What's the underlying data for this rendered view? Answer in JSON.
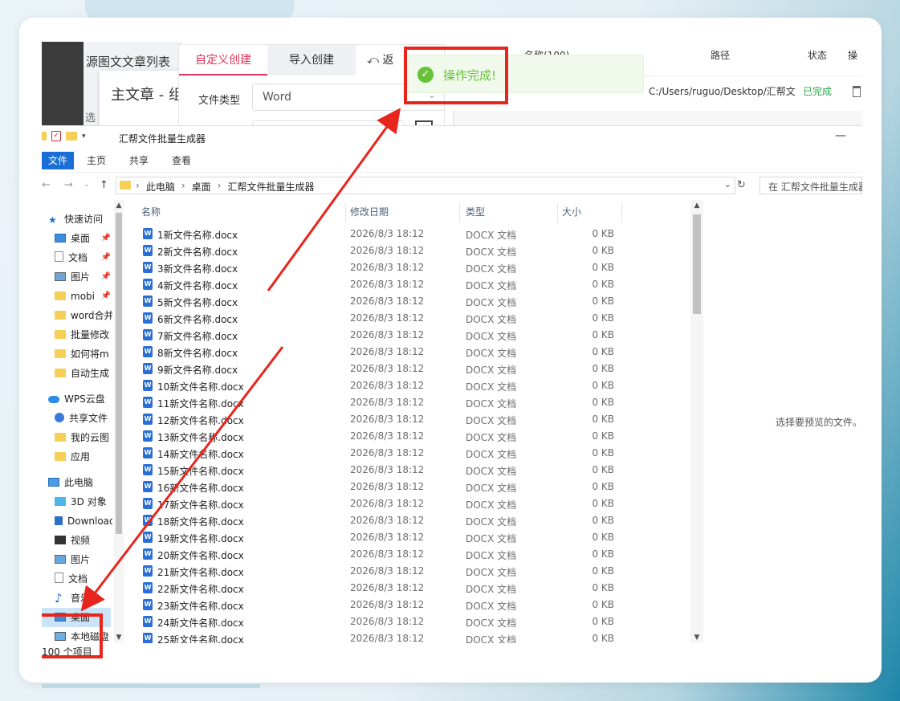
{
  "bg_app": {
    "title": "源图文文章列表",
    "dialog_title": "主文章 - 组",
    "select_label": "选",
    "tabs": [
      "自定义创建",
      "导入创建"
    ],
    "back_label": "返",
    "file_type_label": "文件类型",
    "file_type_value": "Word",
    "table": {
      "headers": [
        "名称(100)",
        "路径",
        "状态",
        "操"
      ],
      "row": {
        "path": "C:/Users/ruguo/Desktop/汇帮文",
        "status": "已完成"
      }
    }
  },
  "toast": {
    "message": "操作完成!"
  },
  "explorer": {
    "title": "汇帮文件批量生成器",
    "ribbon_tabs": [
      "文件",
      "主页",
      "共享",
      "查看"
    ],
    "breadcrumb": [
      "此电脑",
      "桌面",
      "汇帮文件批量生成器"
    ],
    "search_placeholder": "在 汇帮文件批量生成器 中搜索",
    "columns": [
      "名称",
      "修改日期",
      "类型",
      "大小"
    ],
    "sidebar": [
      {
        "label": "快速访问",
        "icon": "star",
        "pin": false
      },
      {
        "label": "桌面",
        "icon": "desk",
        "pin": true
      },
      {
        "label": "文档",
        "icon": "doc",
        "pin": true
      },
      {
        "label": "图片",
        "icon": "img",
        "pin": true
      },
      {
        "label": "mobi",
        "icon": "folder",
        "pin": true
      },
      {
        "label": "word合并",
        "icon": "folder",
        "pin": false
      },
      {
        "label": "批量修改",
        "icon": "folder",
        "pin": false
      },
      {
        "label": "如何将m",
        "icon": "folder",
        "pin": false
      },
      {
        "label": "自动生成",
        "icon": "folder",
        "pin": false
      },
      {
        "label": "WPS云盘",
        "icon": "cloud",
        "pin": false
      },
      {
        "label": "共享文件",
        "icon": "share",
        "pin": false
      },
      {
        "label": "我的云图",
        "icon": "folder",
        "pin": false
      },
      {
        "label": "应用",
        "icon": "folder",
        "pin": false
      },
      {
        "label": "此电脑",
        "icon": "pc",
        "pin": false
      },
      {
        "label": "3D 对象",
        "icon": "cube",
        "pin": false
      },
      {
        "label": "Downloads",
        "icon": "down",
        "pin": false
      },
      {
        "label": "视频",
        "icon": "video",
        "pin": false
      },
      {
        "label": "图片",
        "icon": "img",
        "pin": false
      },
      {
        "label": "文档",
        "icon": "doc",
        "pin": false
      },
      {
        "label": "音乐",
        "icon": "music",
        "pin": false
      },
      {
        "label": "桌面",
        "icon": "desk",
        "pin": false,
        "selected": true
      },
      {
        "label": "本地磁盘",
        "icon": "drive",
        "pin": false
      }
    ],
    "files": [
      {
        "name": "1新文件名称.docx"
      },
      {
        "name": "2新文件名称.docx"
      },
      {
        "name": "3新文件名称.docx"
      },
      {
        "name": "4新文件名称.docx"
      },
      {
        "name": "5新文件名称.docx"
      },
      {
        "name": "6新文件名称.docx"
      },
      {
        "name": "7新文件名称.docx"
      },
      {
        "name": "8新文件名称.docx"
      },
      {
        "name": "9新文件名称.docx"
      },
      {
        "name": "10新文件名称.docx"
      },
      {
        "name": "11新文件名称.docx"
      },
      {
        "name": "12新文件名称.docx"
      },
      {
        "name": "13新文件名称.docx"
      },
      {
        "name": "14新文件名称.docx"
      },
      {
        "name": "15新文件名称.docx"
      },
      {
        "name": "16新文件名称.docx"
      },
      {
        "name": "17新文件名称.docx"
      },
      {
        "name": "18新文件名称.docx"
      },
      {
        "name": "19新文件名称.docx"
      },
      {
        "name": "20新文件名称.docx"
      },
      {
        "name": "21新文件名称.docx"
      },
      {
        "name": "22新文件名称.docx"
      },
      {
        "name": "23新文件名称.docx"
      },
      {
        "name": "24新文件名称.docx"
      },
      {
        "name": "25新文件名称.docx"
      }
    ],
    "file_date": "2026/8/3 18:12",
    "file_type": "DOCX 文档",
    "file_size": "0 KB",
    "status_text": "100 个项目",
    "preview_text": "选择要预览的文件。"
  },
  "colors": {
    "accent": "#e2345c",
    "success": "#67c23a",
    "highlight": "#e8251c",
    "ribbon_file": "#1a6fd6"
  }
}
